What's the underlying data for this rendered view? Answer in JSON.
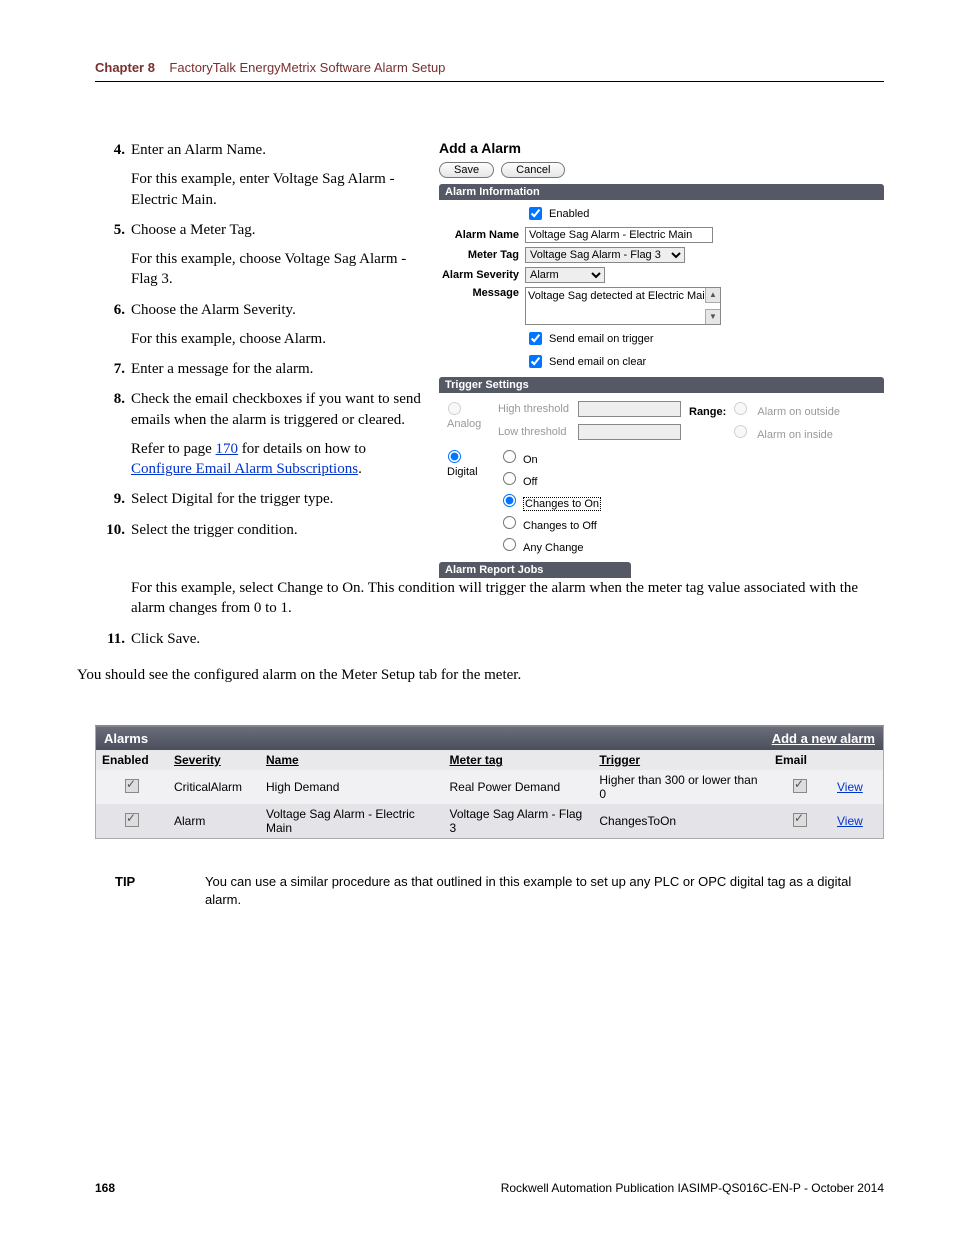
{
  "header": {
    "chapter": "Chapter 8",
    "title": "FactoryTalk EnergyMetrix Software Alarm Setup"
  },
  "steps": {
    "s4": {
      "num": "4.",
      "main": "Enter an Alarm Name.",
      "sub": "For this example, enter Voltage Sag Alarm - Electric Main."
    },
    "s5": {
      "num": "5.",
      "main": "Choose a Meter Tag.",
      "sub": "For this example, choose Voltage Sag Alarm - Flag 3."
    },
    "s6": {
      "num": "6.",
      "main": "Choose the Alarm Severity.",
      "sub": "For this example, choose Alarm."
    },
    "s7": {
      "num": "7.",
      "main": "Enter a message for the alarm."
    },
    "s8": {
      "num": "8.",
      "main": "Check the email checkboxes if you want to send emails when the alarm is triggered or cleared.",
      "sub_pre": "Refer to page ",
      "page_link": "170",
      "sub_mid": " for details on how to ",
      "link": "Configure Email Alarm Subscriptions",
      "sub_post": "."
    },
    "s9": {
      "num": "9.",
      "main": "Select Digital for the trigger type."
    },
    "s10": {
      "num": "10.",
      "main": "Select the trigger condition.",
      "sub": "For this example, select Change to On. This condition will trigger the alarm when the meter tag value associated with the alarm changes from 0 to 1."
    },
    "s11": {
      "num": "11.",
      "main": "Click Save."
    }
  },
  "post_text": "You should see the configured alarm on the Meter Setup tab for the meter.",
  "panel": {
    "title": "Add a Alarm",
    "save": "Save",
    "cancel": "Cancel",
    "sec_info": "Alarm Information",
    "enabled": "Enabled",
    "lbl_name": "Alarm Name",
    "val_name": "Voltage Sag Alarm - Electric Main",
    "lbl_tag": "Meter Tag",
    "val_tag": "Voltage Sag Alarm - Flag 3",
    "lbl_sev": "Alarm Severity",
    "val_sev": "Alarm",
    "lbl_msg": "Message",
    "val_msg": "Voltage Sag detected at Electric Main.",
    "email_trigger": "Send email on trigger",
    "email_clear": "Send email on clear",
    "sec_trigger": "Trigger Settings",
    "analog": "Analog",
    "digital": "Digital",
    "high_thresh": "High threshold",
    "low_thresh": "Low threshold",
    "range": "Range:",
    "alarm_outside": "Alarm on outside",
    "alarm_inside": "Alarm on inside",
    "opt_on": "On",
    "opt_off": "Off",
    "opt_chg_on": "Changes to On",
    "opt_chg_off": "Changes to Off",
    "opt_any": "Any Change",
    "sec_jobs": "Alarm Report Jobs"
  },
  "alarms_table": {
    "title": "Alarms",
    "add_link": "Add a new alarm",
    "headers": {
      "enabled": "Enabled",
      "severity": "Severity",
      "name": "Name",
      "tag": "Meter tag",
      "trigger": "Trigger",
      "email": "Email"
    },
    "rows": [
      {
        "severity": "CriticalAlarm",
        "name": "High Demand",
        "tag": "Real Power Demand",
        "trigger": "Higher than 300 or lower than 0",
        "view": "View"
      },
      {
        "severity": "Alarm",
        "name": "Voltage Sag Alarm - Electric Main",
        "tag": "Voltage Sag Alarm - Flag 3",
        "trigger": "ChangesToOn",
        "view": "View"
      }
    ]
  },
  "tip": {
    "label": "TIP",
    "text": "You can use a similar procedure as that outlined in this example to set up any PLC or OPC digital tag as a digital alarm."
  },
  "footer": {
    "page": "168",
    "pub": "Rockwell Automation Publication IASIMP-QS016C-EN-P - October 2014"
  }
}
